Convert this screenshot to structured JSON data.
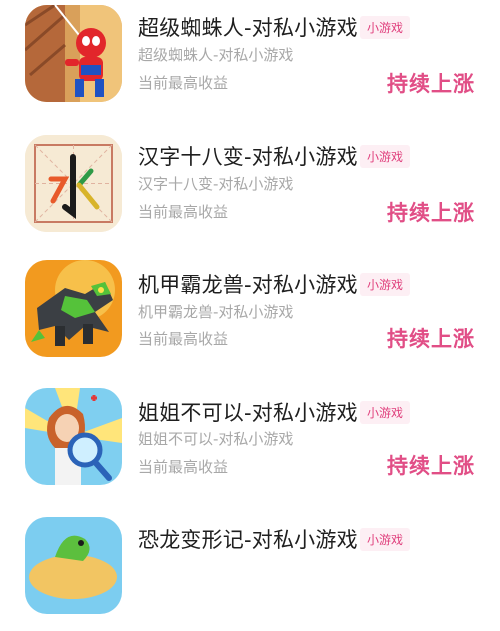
{
  "games": [
    {
      "title": "超级蜘蛛人-对私小游戏",
      "tag": "小游戏",
      "subtitle": "超级蜘蛛人-对私小游戏",
      "earn_label": "当前最高收益",
      "earn_value": "持续上涨",
      "icon": "spiderman-game-icon"
    },
    {
      "title": "汉字十八变-对私小游戏",
      "tag": "小游戏",
      "subtitle": "汉字十八变-对私小游戏",
      "earn_label": "当前最高收益",
      "earn_value": "持续上涨",
      "icon": "chinese-character-game-icon",
      "icon_char": "水"
    },
    {
      "title": "机甲霸龙兽-对私小游戏",
      "tag": "小游戏",
      "subtitle": "机甲霸龙兽-对私小游戏",
      "earn_label": "当前最高收益",
      "earn_value": "持续上涨",
      "icon": "mecha-dragon-game-icon"
    },
    {
      "title": "姐姐不可以-对私小游戏",
      "tag": "小游戏",
      "subtitle": "姐姐不可以-对私小游戏",
      "earn_label": "当前最高收益",
      "earn_value": "持续上涨",
      "icon": "sister-magnifier-game-icon"
    },
    {
      "title": "恐龙变形记-对私小游戏",
      "tag": "小游戏",
      "icon": "dinosaur-game-icon"
    }
  ],
  "colors": {
    "accent": "#e14e86",
    "tag_bg": "#fdeff4",
    "muted_text": "#a8a8a8",
    "title_text": "#1f1f1f"
  }
}
